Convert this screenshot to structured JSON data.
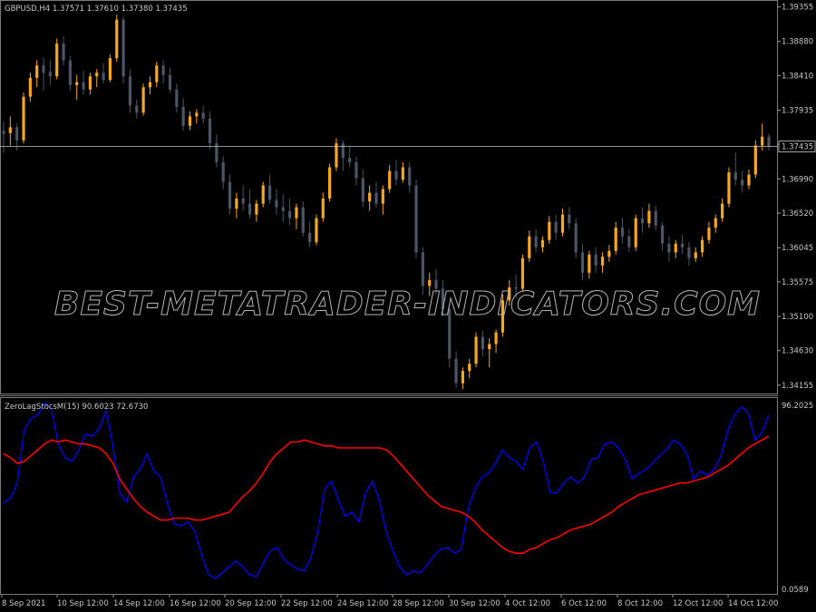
{
  "main_panel": {
    "header": "GBPUSD,H4  1.37571  1.37610  1.37380  1.37435",
    "current_price_label": "1.37435",
    "price_axis": [
      "1.39355",
      "1.38880",
      "1.38410",
      "1.37935",
      "1.37465",
      "1.36990",
      "1.36520",
      "1.36045",
      "1.35575",
      "1.35100",
      "1.34630",
      "1.34155"
    ]
  },
  "indicator_panel": {
    "header": "ZeroLagStocsM(15) 90.6023 72.6730",
    "axis_top": "96.2025",
    "axis_bottom": "0.0589"
  },
  "time_axis": [
    "8 Sep 2021",
    "10 Sep 12:00",
    "14 Sep 12:00",
    "16 Sep 12:00",
    "20 Sep 12:00",
    "22 Sep 12:00",
    "24 Sep 12:00",
    "28 Sep 12:00",
    "30 Sep 12:00",
    "4 Oct 12:00",
    "6 Oct 12:00",
    "8 Oct 12:00",
    "12 Oct 12:00",
    "14 Oct 12:00"
  ],
  "watermark": "BEST-METATRADER-INDICATORS.COM",
  "colors": {
    "background": "#000000",
    "bull_candle": "#f5a623",
    "bear_candle": "#4b5566",
    "stoch_main": "#0000ff",
    "stoch_signal": "#ff0000",
    "grid_text": "#c8c8c8",
    "price_line": "#c0c0c0"
  },
  "chart_data": [
    {
      "type": "candlestick",
      "title": "GBPUSD,H4",
      "ylim": [
        1.3404,
        1.3945
      ],
      "current_price": 1.37435,
      "ohlc": [
        [
          1.3765,
          1.3778,
          1.3735,
          1.3761
        ],
        [
          1.3762,
          1.3785,
          1.3745,
          1.377
        ],
        [
          1.377,
          1.3775,
          1.3738,
          1.3752
        ],
        [
          1.3752,
          1.3818,
          1.3748,
          1.3812
        ],
        [
          1.3812,
          1.3845,
          1.3805,
          1.3838
        ],
        [
          1.3838,
          1.3862,
          1.3825,
          1.3855
        ],
        [
          1.3855,
          1.3866,
          1.382,
          1.3845
        ],
        [
          1.3846,
          1.3862,
          1.3828,
          1.384
        ],
        [
          1.384,
          1.3892,
          1.3836,
          1.3885
        ],
        [
          1.3885,
          1.3895,
          1.3855,
          1.3862
        ],
        [
          1.3862,
          1.3868,
          1.382,
          1.3828
        ],
        [
          1.3828,
          1.3842,
          1.3808,
          1.3832
        ],
        [
          1.3832,
          1.3848,
          1.3815,
          1.3822
        ],
        [
          1.3822,
          1.3845,
          1.3815,
          1.384
        ],
        [
          1.384,
          1.385,
          1.3825,
          1.3845
        ],
        [
          1.3845,
          1.3858,
          1.383,
          1.3835
        ],
        [
          1.3835,
          1.387,
          1.3832,
          1.3865
        ],
        [
          1.3865,
          1.3925,
          1.386,
          1.3918
        ],
        [
          1.3918,
          1.3922,
          1.383,
          1.384
        ],
        [
          1.384,
          1.385,
          1.379,
          1.38
        ],
        [
          1.38,
          1.3808,
          1.3782,
          1.379
        ],
        [
          1.379,
          1.383,
          1.3786,
          1.3825
        ],
        [
          1.3825,
          1.384,
          1.3815,
          1.3832
        ],
        [
          1.3832,
          1.386,
          1.3825,
          1.3855
        ],
        [
          1.3855,
          1.3862,
          1.383,
          1.3842
        ],
        [
          1.3842,
          1.3852,
          1.3818,
          1.3822
        ],
        [
          1.3822,
          1.383,
          1.379,
          1.3798
        ],
        [
          1.3798,
          1.381,
          1.3765,
          1.3772
        ],
        [
          1.3772,
          1.3792,
          1.3766,
          1.3785
        ],
        [
          1.3785,
          1.3795,
          1.3775,
          1.379
        ],
        [
          1.379,
          1.38,
          1.3775,
          1.3782
        ],
        [
          1.3782,
          1.3792,
          1.374,
          1.3748
        ],
        [
          1.3748,
          1.376,
          1.3715,
          1.3722
        ],
        [
          1.3722,
          1.373,
          1.3685,
          1.3695
        ],
        [
          1.3695,
          1.3705,
          1.365,
          1.3658
        ],
        [
          1.3658,
          1.368,
          1.3645,
          1.3672
        ],
        [
          1.3672,
          1.369,
          1.3655,
          1.3665
        ],
        [
          1.3665,
          1.3685,
          1.3645,
          1.365
        ],
        [
          1.365,
          1.367,
          1.364,
          1.3665
        ],
        [
          1.3665,
          1.3695,
          1.366,
          1.369
        ],
        [
          1.369,
          1.3705,
          1.3665,
          1.367
        ],
        [
          1.367,
          1.3685,
          1.365,
          1.366
        ],
        [
          1.366,
          1.3678,
          1.364,
          1.3655
        ],
        [
          1.3655,
          1.3672,
          1.3635,
          1.3645
        ],
        [
          1.3645,
          1.3665,
          1.363,
          1.366
        ],
        [
          1.366,
          1.3668,
          1.362,
          1.3625
        ],
        [
          1.3625,
          1.364,
          1.3605,
          1.3612
        ],
        [
          1.3612,
          1.365,
          1.3608,
          1.3645
        ],
        [
          1.3645,
          1.368,
          1.364,
          1.3672
        ],
        [
          1.3672,
          1.372,
          1.3668,
          1.3715
        ],
        [
          1.3715,
          1.3755,
          1.371,
          1.3748
        ],
        [
          1.3748,
          1.3752,
          1.371,
          1.3728
        ],
        [
          1.3728,
          1.3745,
          1.3715,
          1.3722
        ],
        [
          1.3722,
          1.373,
          1.369,
          1.37
        ],
        [
          1.37,
          1.3712,
          1.366,
          1.3668
        ],
        [
          1.3668,
          1.369,
          1.3655,
          1.368
        ],
        [
          1.368,
          1.3695,
          1.366,
          1.3665
        ],
        [
          1.3665,
          1.369,
          1.365,
          1.3685
        ],
        [
          1.3685,
          1.3718,
          1.368,
          1.371
        ],
        [
          1.371,
          1.3725,
          1.369,
          1.3698
        ],
        [
          1.3698,
          1.3722,
          1.3694,
          1.3715
        ],
        [
          1.3715,
          1.3722,
          1.368,
          1.369
        ],
        [
          1.369,
          1.3698,
          1.359,
          1.3598
        ],
        [
          1.3598,
          1.3605,
          1.354,
          1.3552
        ],
        [
          1.3552,
          1.357,
          1.3538,
          1.356
        ],
        [
          1.356,
          1.3575,
          1.354,
          1.3548
        ],
        [
          1.3548,
          1.356,
          1.351,
          1.352
        ],
        [
          1.352,
          1.3525,
          1.344,
          1.3452
        ],
        [
          1.3452,
          1.3462,
          1.3412,
          1.3418
        ],
        [
          1.3418,
          1.344,
          1.341,
          1.3435
        ],
        [
          1.3435,
          1.3452,
          1.3425,
          1.3445
        ],
        [
          1.3445,
          1.3488,
          1.344,
          1.3482
        ],
        [
          1.3482,
          1.349,
          1.3455,
          1.3465
        ],
        [
          1.3465,
          1.348,
          1.344,
          1.3472
        ],
        [
          1.3472,
          1.3492,
          1.346,
          1.3488
        ],
        [
          1.3488,
          1.354,
          1.3482,
          1.3532
        ],
        [
          1.3532,
          1.356,
          1.3525,
          1.355
        ],
        [
          1.355,
          1.3568,
          1.3535,
          1.3548
        ],
        [
          1.3548,
          1.3595,
          1.3545,
          1.359
        ],
        [
          1.359,
          1.3628,
          1.3585,
          1.362
        ],
        [
          1.362,
          1.363,
          1.3598,
          1.3605
        ],
        [
          1.3605,
          1.362,
          1.3598,
          1.3615
        ],
        [
          1.3615,
          1.3648,
          1.361,
          1.364
        ],
        [
          1.364,
          1.365,
          1.3615,
          1.3625
        ],
        [
          1.3625,
          1.3658,
          1.362,
          1.365
        ],
        [
          1.365,
          1.366,
          1.363,
          1.3638
        ],
        [
          1.3638,
          1.3645,
          1.359,
          1.3598
        ],
        [
          1.3598,
          1.361,
          1.356,
          1.357
        ],
        [
          1.357,
          1.36,
          1.3562,
          1.3595
        ],
        [
          1.3595,
          1.3605,
          1.357,
          1.358
        ],
        [
          1.358,
          1.3598,
          1.357,
          1.3592
        ],
        [
          1.3592,
          1.3608,
          1.3585,
          1.36
        ],
        [
          1.36,
          1.364,
          1.3595,
          1.3632
        ],
        [
          1.3632,
          1.3645,
          1.361,
          1.362
        ],
        [
          1.362,
          1.363,
          1.3598,
          1.3605
        ],
        [
          1.3605,
          1.365,
          1.36,
          1.3645
        ],
        [
          1.3645,
          1.366,
          1.3625,
          1.3638
        ],
        [
          1.3638,
          1.3665,
          1.3632,
          1.3655
        ],
        [
          1.3655,
          1.3662,
          1.3628,
          1.3635
        ],
        [
          1.3635,
          1.364,
          1.36,
          1.361
        ],
        [
          1.361,
          1.362,
          1.3585,
          1.3598
        ],
        [
          1.3598,
          1.3615,
          1.359,
          1.361
        ],
        [
          1.361,
          1.3622,
          1.3596,
          1.3605
        ],
        [
          1.3605,
          1.3612,
          1.358,
          1.359
        ],
        [
          1.359,
          1.3605,
          1.3585,
          1.3598
        ],
        [
          1.3598,
          1.362,
          1.3592,
          1.3615
        ],
        [
          1.3615,
          1.364,
          1.361,
          1.3632
        ],
        [
          1.3632,
          1.365,
          1.3625,
          1.3645
        ],
        [
          1.3645,
          1.3672,
          1.364,
          1.3665
        ],
        [
          1.3665,
          1.3715,
          1.366,
          1.3708
        ],
        [
          1.3708,
          1.3735,
          1.369,
          1.3698
        ],
        [
          1.3698,
          1.371,
          1.368,
          1.369
        ],
        [
          1.369,
          1.3712,
          1.3685,
          1.3705
        ],
        [
          1.3705,
          1.3752,
          1.37,
          1.3745
        ],
        [
          1.3745,
          1.3775,
          1.3738,
          1.3757
        ],
        [
          1.3757,
          1.3761,
          1.3738,
          1.37435
        ]
      ]
    },
    {
      "type": "line",
      "title": "ZeroLagStocsM(15)",
      "ylim": [
        0.0589,
        96.2025
      ],
      "series": [
        {
          "name": "main",
          "values": [
            45,
            47,
            55,
            82,
            88,
            90,
            96,
            93,
            75,
            68,
            66,
            72,
            80,
            79,
            83,
            92,
            74,
            50,
            45,
            58,
            62,
            70,
            61,
            58,
            44,
            34,
            33,
            35,
            30,
            18,
            8,
            6,
            9,
            12,
            15,
            12,
            8,
            7,
            14,
            20,
            22,
            16,
            13,
            11,
            10,
            17,
            30,
            52,
            56,
            46,
            38,
            40,
            35,
            50,
            56,
            46,
            30,
            20,
            12,
            8,
            10,
            9,
            13,
            18,
            21,
            22,
            19,
            21,
            42,
            52,
            58,
            60,
            65,
            72,
            68,
            66,
            62,
            73,
            76,
            66,
            50,
            50,
            55,
            58,
            55,
            58,
            67,
            68,
            75,
            76,
            73,
            67,
            57,
            60,
            62,
            65,
            69,
            72,
            77,
            75,
            70,
            57,
            61,
            59,
            62,
            69,
            82,
            90,
            94,
            91,
            77,
            81,
            90
          ]
        },
        {
          "name": "signal",
          "values": [
            70,
            68,
            65,
            66,
            69,
            72,
            75,
            77,
            76,
            77,
            76,
            75,
            75,
            74,
            73,
            70,
            65,
            57,
            52,
            47,
            43,
            40,
            38,
            36,
            36,
            37,
            37,
            37,
            36,
            36,
            37,
            38,
            39,
            40,
            44,
            48,
            51,
            55,
            60,
            66,
            70,
            73,
            76,
            76,
            77,
            76,
            75,
            74,
            74,
            73,
            73,
            73,
            73,
            73,
            73,
            73,
            72,
            69,
            65,
            61,
            57,
            53,
            49,
            46,
            43,
            42,
            41,
            40,
            38,
            35,
            31,
            28,
            25,
            22,
            20,
            19,
            19,
            21,
            22,
            24,
            26,
            27,
            29,
            31,
            32,
            33,
            34,
            36,
            38,
            40,
            43,
            45,
            47,
            49,
            50,
            51,
            52,
            53,
            54,
            55,
            55,
            56,
            57,
            58,
            60,
            62,
            64,
            67,
            70,
            73,
            75,
            77,
            79
          ]
        }
      ]
    }
  ]
}
